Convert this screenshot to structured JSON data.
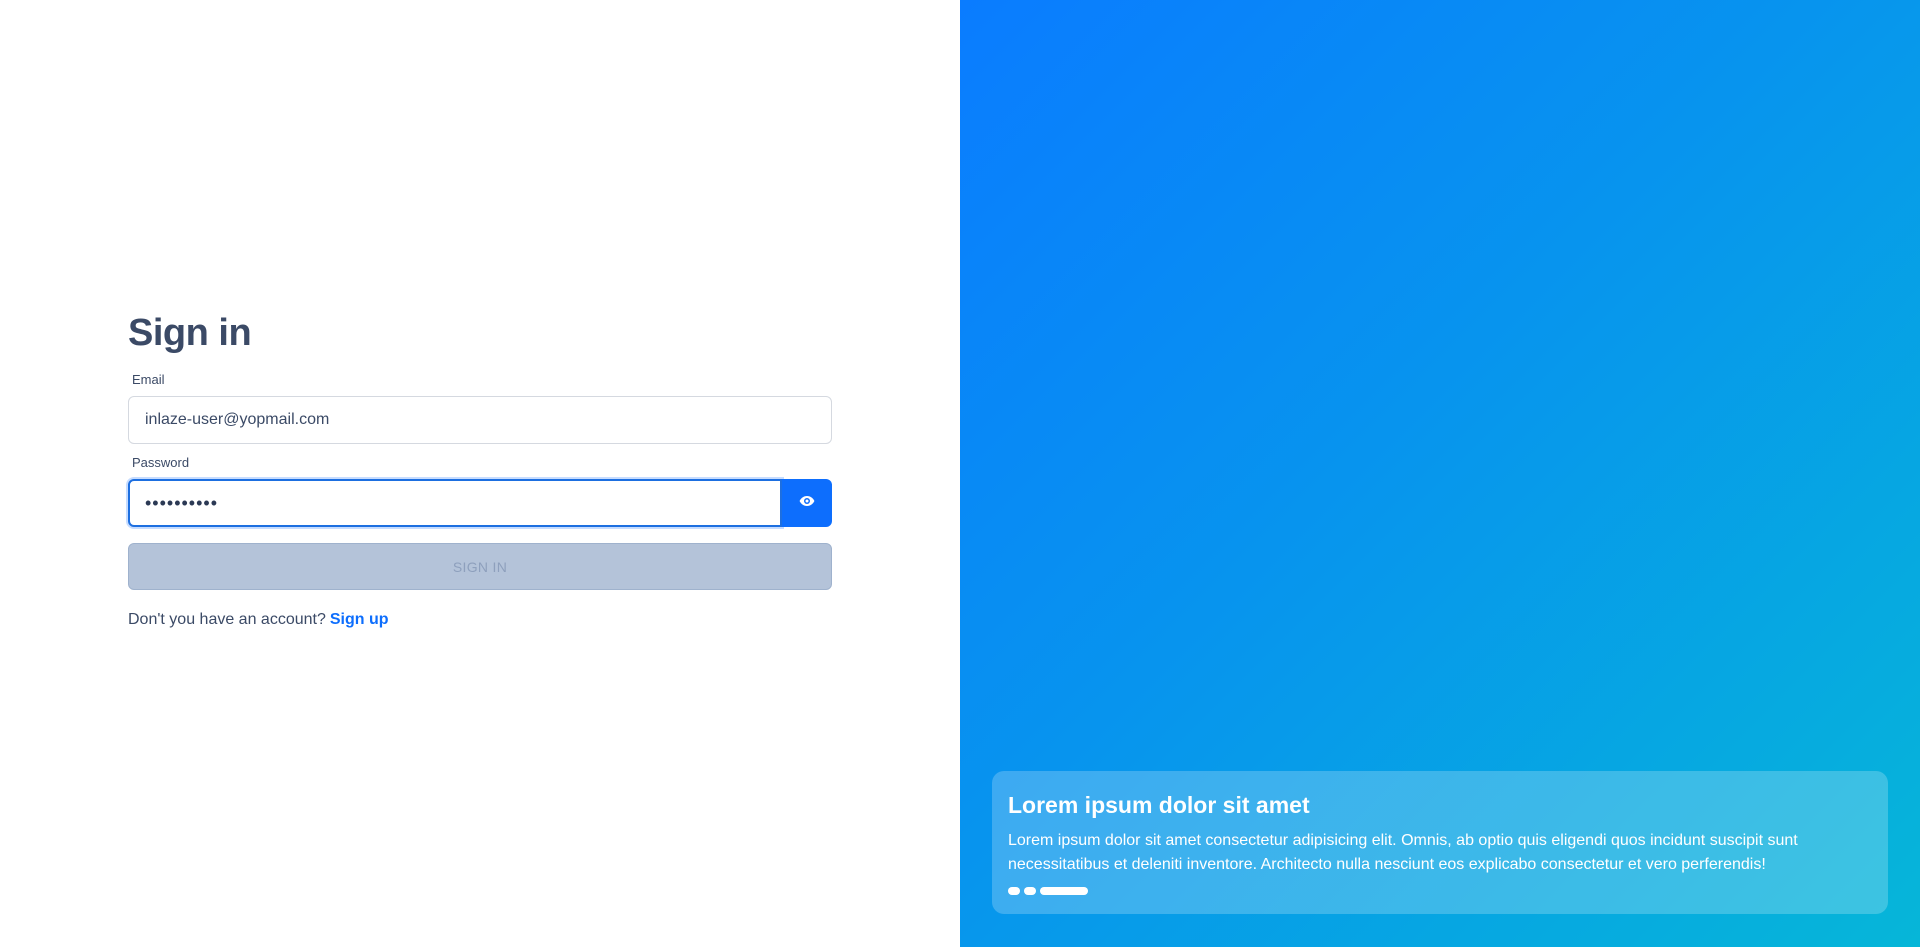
{
  "login": {
    "title": "Sign in",
    "email_label": "Email",
    "email_value": "inlaze-user@yopmail.com",
    "password_label": "Password",
    "password_value": "••••••••••",
    "signin_label": "SIGN IN",
    "signup_prompt": "Don't you have an account?",
    "signup_link": "Sign up"
  },
  "promo": {
    "title": "Lorem ipsum dolor sit amet",
    "text": "Lorem ipsum dolor sit amet consectetur adipisicing elit. Omnis, ab optio quis eligendi quos incidunt suscipit sunt necessitatibus et deleniti inventore. Architecto nulla nesciunt eos explicabo consectetur et vero perferendis!"
  },
  "colors": {
    "accent": "#0d6efd",
    "text": "#3b4a66",
    "disabled_button": "#b4c3d9",
    "gradient_start": "#0a7cff",
    "gradient_end": "#06b6d8"
  },
  "icons": {
    "password_toggle": "eye-icon"
  }
}
